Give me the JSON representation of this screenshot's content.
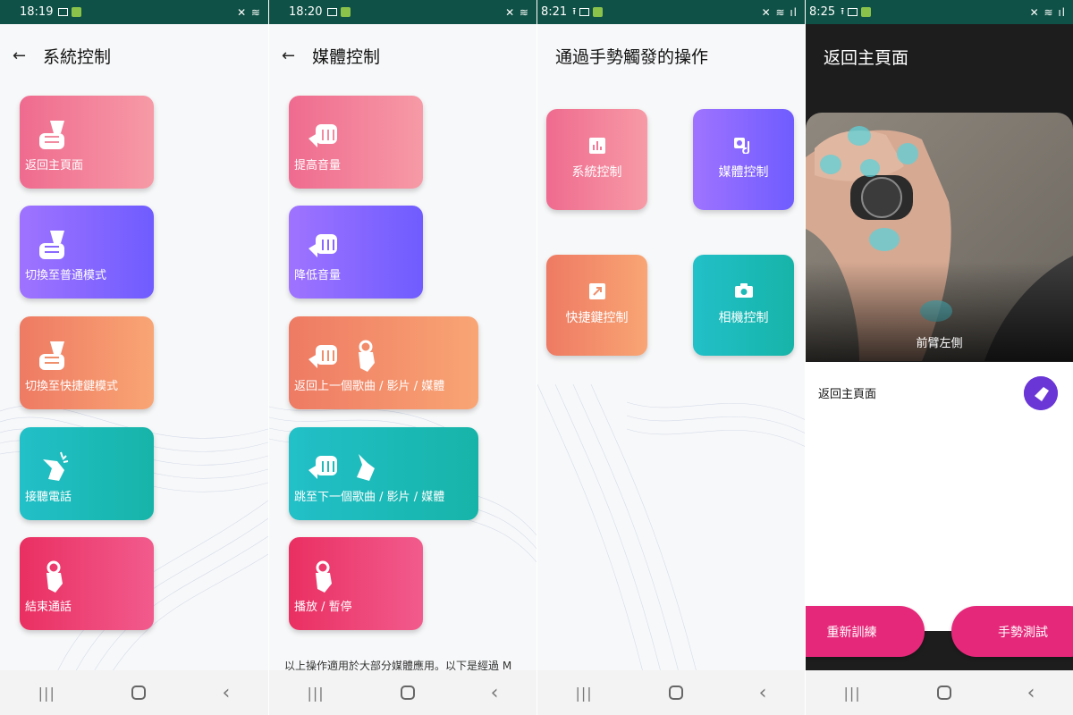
{
  "screens": [
    {
      "status_time": "18:19",
      "title": "系統控制",
      "cards": [
        {
          "label": "返回主頁面",
          "icon": "hand-fist-gesture-icon",
          "color": "pink"
        },
        {
          "label": "切換至普通模式",
          "icon": "hand-fist-gesture-icon",
          "color": "purple"
        },
        {
          "label": "切換至快捷鍵模式",
          "icon": "hand-fist-gesture-icon",
          "color": "orange"
        },
        {
          "label": "接聽電話",
          "icon": "hand-snap-gesture-icon",
          "color": "teal"
        },
        {
          "label": "結束通話",
          "icon": "hand-ok-gesture-icon",
          "color": "red"
        }
      ]
    },
    {
      "status_time": "18:20",
      "title": "媒體控制",
      "cards": [
        {
          "label": "提高音量",
          "icon": "hand-rotate-gesture-icon",
          "color": "pink"
        },
        {
          "label": "降低音量",
          "icon": "hand-rotate-gesture-icon",
          "color": "purple"
        },
        {
          "label": "返回上一個歌曲 / 影片 / 媒體",
          "icon": "hand-combo-gesture-icon",
          "color": "orange"
        },
        {
          "label": "跳至下一個歌曲 / 影片 / 媒體",
          "icon": "hand-combo-gesture-icon",
          "color": "teal"
        },
        {
          "label": "播放 / 暫停",
          "icon": "hand-ok-gesture-icon",
          "color": "red"
        }
      ],
      "note": "以上操作適用於大部分媒體應用。以下是經過 M"
    },
    {
      "status_time": "8:21",
      "title": "通過手勢觸發的操作",
      "tiles": [
        {
          "label": "系統控制",
          "icon": "bar-chart-icon",
          "color": "pink"
        },
        {
          "label": "媒體控制",
          "icon": "media-icon",
          "color": "purple"
        },
        {
          "label": "快捷鍵控制",
          "icon": "shortcut-arrow-icon",
          "color": "orange"
        },
        {
          "label": "相機控制",
          "icon": "camera-icon",
          "color": "teal"
        }
      ]
    },
    {
      "status_time": "8:25",
      "title": "返回主頁面",
      "photo_caption": "前臂左側",
      "row_label": "返回主頁面",
      "buttons": {
        "retrain": "重新訓練",
        "test": "手勢測試"
      }
    }
  ],
  "colors": {
    "status_bar": "#0f5146",
    "accent_pink": "#e6287a"
  }
}
